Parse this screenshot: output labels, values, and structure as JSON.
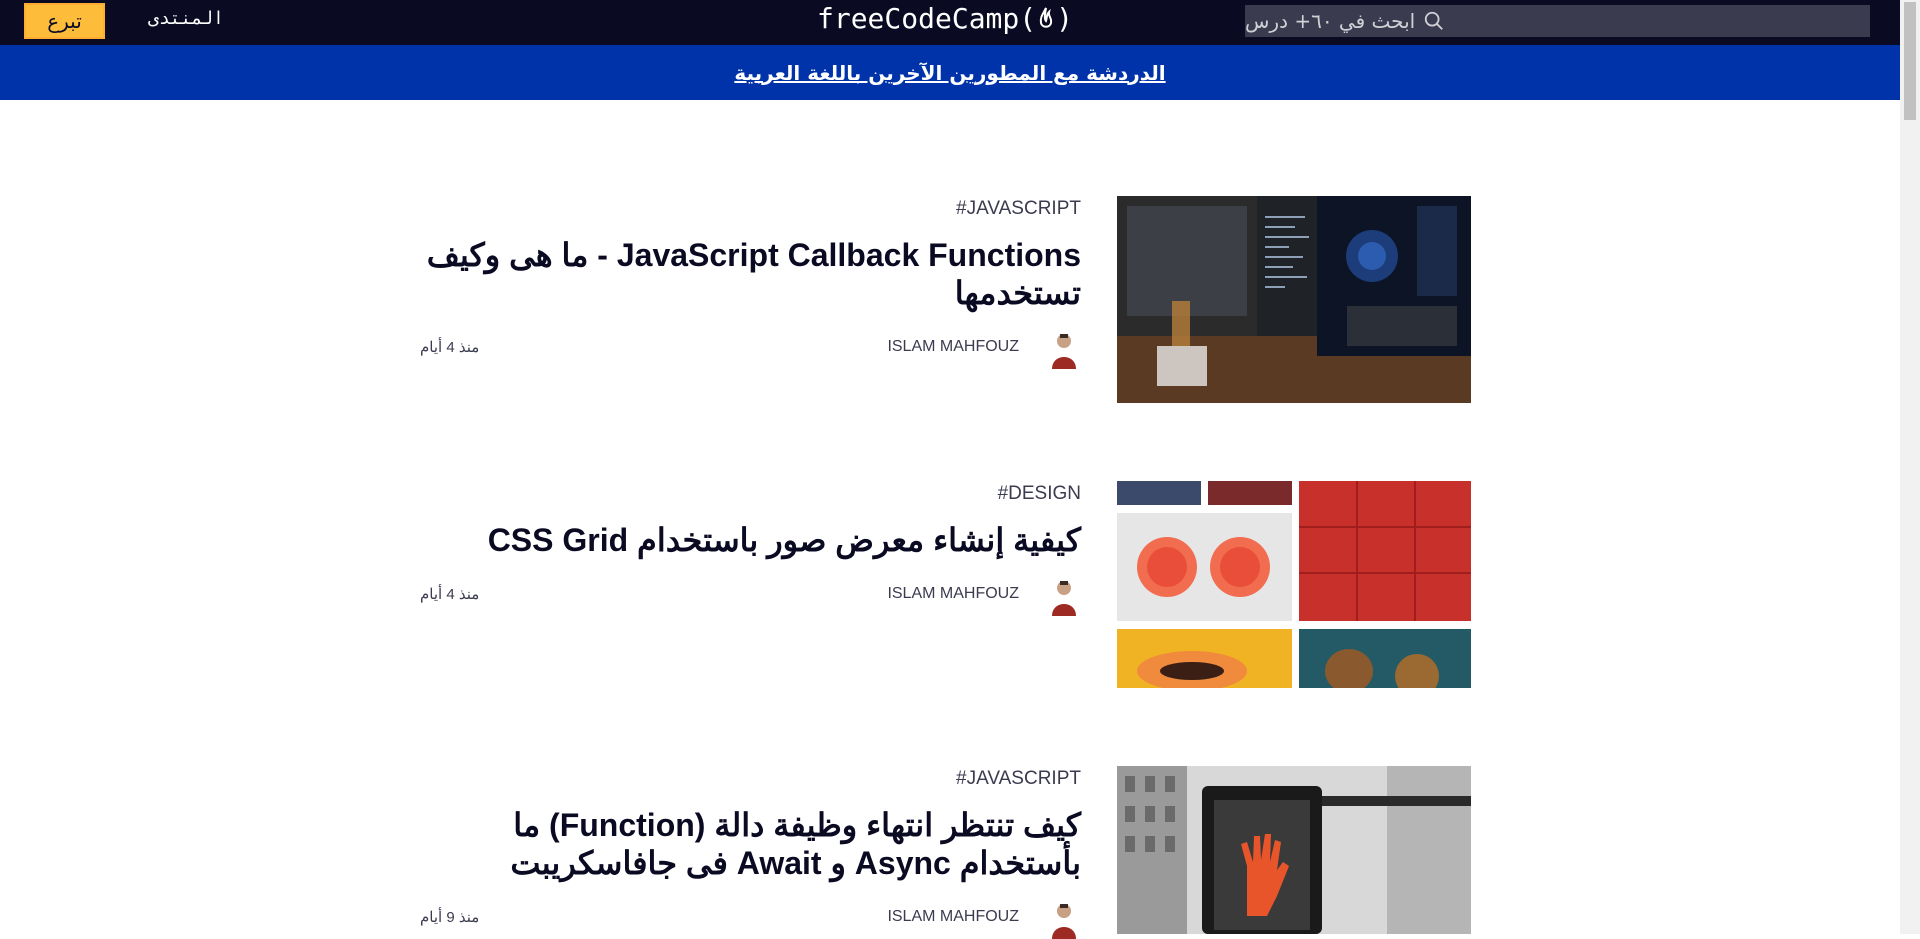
{
  "nav": {
    "search_placeholder": "ابحث في ٦٠+ درس",
    "logo": "freeCodeCamp",
    "forum": "المنتدى",
    "donate": "تبرع"
  },
  "banner": {
    "text": "الدردشة مع المطورين الآخرين باللغة العربية"
  },
  "posts": [
    {
      "tag": "#JAVASCRIPT",
      "title": "JavaScript Callback Functions - ما هى وكيف تستخدمها",
      "author": "ISLAM MAHFOUZ",
      "time": "منذ 4 أيام",
      "image": "monitors-desk"
    },
    {
      "tag": "#DESIGN",
      "title": "كيفية إنشاء معرض صور باستخدام CSS Grid",
      "author": "ISLAM MAHFOUZ",
      "time": "منذ 4 أيام",
      "image": "fruit-grid"
    },
    {
      "tag": "#JAVASCRIPT",
      "title": "كيف تنتظر انتهاء وظيفة دالة (Function) ما بأستخدام Async و Await فى جافاسكريبت",
      "author": "ISLAM MAHFOUZ",
      "time": "منذ 9 أيام",
      "image": "crosswalk-signal"
    }
  ],
  "colors": {
    "nav_bg": "#0a0a23",
    "banner_bg": "#0033aa",
    "donate_bg": "#febc3b",
    "text_dark": "#0a0a23"
  }
}
